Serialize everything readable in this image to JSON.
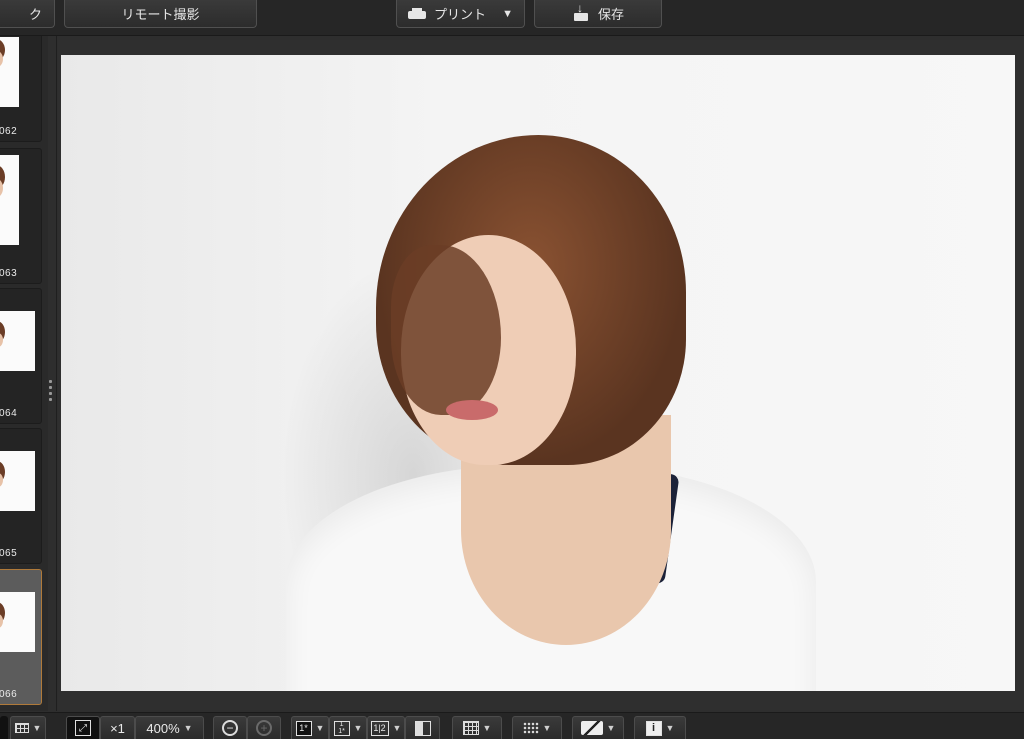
{
  "toolbar": {
    "left_partial_label": "ク",
    "remote_label": "リモート撮影",
    "print_label": "プリント",
    "print_caret": "▼",
    "save_label": "保存"
  },
  "filmstrip": {
    "items": [
      {
        "label": "062",
        "selected": false
      },
      {
        "label": "063",
        "selected": false
      },
      {
        "label": "064",
        "selected": false
      },
      {
        "label": "065",
        "selected": false
      },
      {
        "label": "066",
        "selected": true
      }
    ]
  },
  "bottombar": {
    "zoom_1x_label": "×1",
    "zoom_value": "400%",
    "zoom_out_symbol": "−",
    "zoom_in_symbol": "+",
    "single_view_symbol": "1*",
    "compare_top_symbol": "1",
    "compare_bottom_symbol": "1*",
    "side_by_side_symbol": "1|2",
    "info_symbol": "i",
    "dropdown_caret": "▼"
  },
  "colors": {
    "selected_border": "#b07a3a",
    "toolbar_bg": "#262626",
    "viewer_bg": "#2f2f2f"
  }
}
